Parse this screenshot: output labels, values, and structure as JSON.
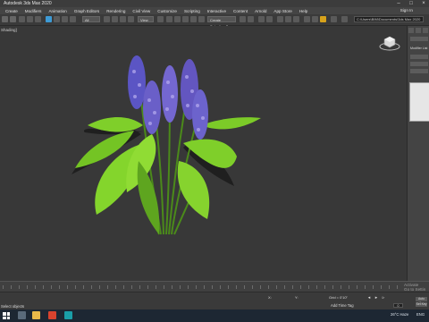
{
  "window": {
    "title": "Autodesk 3ds Max 2020"
  },
  "menu": [
    "Create",
    "Modifiers",
    "Animation",
    "Graph Editors",
    "Rendering",
    "Civil View",
    "Customize",
    "Scripting",
    "Interactive",
    "Content",
    "Arnold",
    "App Store",
    "Help"
  ],
  "account": {
    "sign_in": "Sign In"
  },
  "toolbar": {
    "filter_select": "All",
    "view_select": "View",
    "selection_set": "Create Selection Se",
    "path": "C:\\Users\\BIM\\Documents\\3ds Max 2020"
  },
  "viewport": {
    "label": "[+] [Perspective] [Standard] [Default Shading]",
    "label_short": "Shading]"
  },
  "command_panel": {
    "label": "Modifier List"
  },
  "timeline": {
    "watermark_1": "Activate",
    "watermark_2": "Go to Settin"
  },
  "status": {
    "selection": "None Selected",
    "prompt": "Select objects",
    "add_time_tag": "Add Time Tag",
    "auto_key": "Auto Key",
    "set_key": "Set Key",
    "coord_x": "X:",
    "coord_y": "Y:",
    "grid": "Grid = 0'10\"",
    "frame": "0"
  },
  "taskbar": {
    "weather": "26°C Haze",
    "language": "ENG"
  },
  "colors": {
    "accent": "#3e9bd6",
    "flower": "#6a5fc8",
    "leaf": "#7fcf2a",
    "viewport_bg": "#383838"
  }
}
